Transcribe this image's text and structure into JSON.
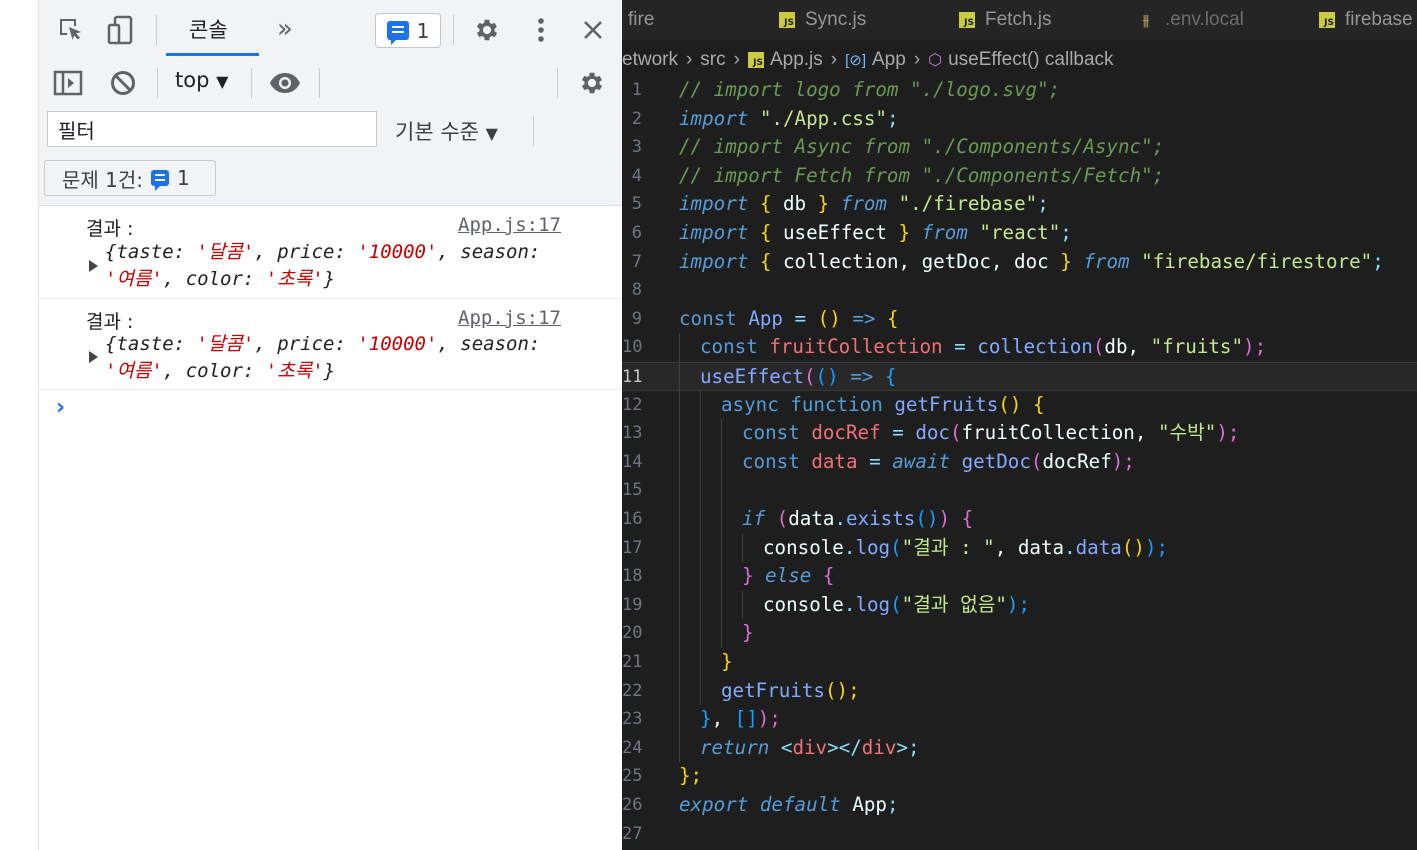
{
  "devtools": {
    "toolbar": {
      "console_tab_label": "콘솔",
      "more_tabs_label": "»",
      "issues_count": "1",
      "context_label": "top"
    },
    "filter": {
      "value": "필터",
      "level_label": "기본 수준"
    },
    "issues_bar": {
      "label": "문제 1건:",
      "count": "1"
    },
    "logs": [
      {
        "prefix": "결과 :",
        "source": "App.js:17",
        "open": "{",
        "k1": "taste: ",
        "v1": "'달콤'",
        "k2": ", price: ",
        "v2": "'10000'",
        "k3": ", season: ",
        "v3": "'여름'",
        "k4": ", color: ",
        "v4": "'초록'",
        "close": "}"
      },
      {
        "prefix": "결과 :",
        "source": "App.js:17",
        "open": "{",
        "k1": "taste: ",
        "v1": "'달콤'",
        "k2": ", price: ",
        "v2": "'10000'",
        "k3": ", season: ",
        "v3": "'여름'",
        "k4": ", color: ",
        "v4": "'초록'",
        "close": "}"
      }
    ],
    "prompt": "›"
  },
  "editor": {
    "tabs": [
      {
        "label": "fire",
        "icon": "none"
      },
      {
        "label": "Sync.js",
        "icon": "js-file-icon"
      },
      {
        "label": "Fetch.js",
        "icon": "js-file-icon"
      },
      {
        "label": ".env.local",
        "icon": "settings-file-icon"
      },
      {
        "label": "firebase",
        "icon": "js-file-icon"
      }
    ],
    "breadcrumb": {
      "part1": "etwork",
      "part2": "src",
      "part3": "App.js",
      "part4": "App",
      "part5": "useEffect() callback"
    },
    "line_numbers": [
      "1",
      "2",
      "3",
      "4",
      "5",
      "6",
      "7",
      "8",
      "9",
      "10",
      "11",
      "12",
      "13",
      "14",
      "15",
      "16",
      "17",
      "18",
      "19",
      "20",
      "21",
      "22",
      "23",
      "24",
      "25",
      "26",
      "27"
    ],
    "code": {
      "l1": [
        "// import logo from \"./logo.svg\";"
      ],
      "l2": [
        "import",
        " ",
        "\"./App.css\"",
        ";"
      ],
      "l3": [
        "// import Async from \"./Components/Async\";"
      ],
      "l4": [
        "// import Fetch from \"./Components/Fetch\";"
      ],
      "l5": [
        "import",
        " ",
        "{",
        " db ",
        "}",
        " ",
        "from",
        " ",
        "\"./firebase\"",
        ";"
      ],
      "l6": [
        "import",
        " ",
        "{",
        " useEffect ",
        "}",
        " ",
        "from",
        " ",
        "\"react\"",
        ";"
      ],
      "l7": [
        "import",
        " ",
        "{",
        " collection, getDoc, doc ",
        "}",
        " ",
        "from",
        " ",
        "\"firebase/firestore\"",
        ";"
      ],
      "l9": [
        "const",
        " ",
        "App",
        " ",
        "=",
        " ",
        "()",
        " ",
        "=>",
        " ",
        "{"
      ],
      "l10": [
        "const",
        " ",
        "fruitCollection",
        " ",
        "=",
        " ",
        "collection",
        "(",
        "db",
        ", ",
        "\"fruits\"",
        ");"
      ],
      "l11": [
        "useEffect",
        "(",
        "()",
        " ",
        "=>",
        " ",
        "{"
      ],
      "l12": [
        "async",
        " ",
        "function",
        " ",
        "getFruits",
        "()",
        " ",
        "{"
      ],
      "l13": [
        "const",
        " ",
        "docRef",
        " ",
        "=",
        " ",
        "doc",
        "(",
        "fruitCollection",
        ", ",
        "\"수박\"",
        ");"
      ],
      "l14": [
        "const",
        " ",
        "data",
        " ",
        "=",
        " ",
        "await",
        " ",
        "getDoc",
        "(",
        "docRef",
        ");"
      ],
      "l16": [
        "if",
        " ",
        "(",
        "data",
        ".",
        "exists",
        "()",
        ")",
        " ",
        "{"
      ],
      "l17": [
        "console",
        ".",
        "log",
        "(",
        "\"결과 : \"",
        ", ",
        "data",
        ".",
        "data",
        "()",
        ");"
      ],
      "l18": [
        "}",
        " ",
        "else",
        " ",
        "{"
      ],
      "l19": [
        "console",
        ".",
        "log",
        "(",
        "\"결과 없음\"",
        ");"
      ],
      "l20": [
        "}"
      ],
      "l21": [
        "}"
      ],
      "l22": [
        "getFruits",
        "();"
      ],
      "l23": [
        "}",
        ", ",
        "[]",
        ");"
      ],
      "l24": [
        "return",
        " ",
        "<",
        "div",
        "></",
        "div",
        ">;"
      ],
      "l25": [
        "};"
      ],
      "l26": [
        "export",
        " ",
        "default",
        " ",
        "App",
        ";"
      ]
    },
    "active_line": "11"
  },
  "colors": {
    "editor_bg": "#1e1e1e",
    "comment": "#6a9955",
    "keyword": "#569cd6",
    "string": "#c3e88d",
    "variable": "#f07178",
    "function": "#82aaff",
    "devtools_accent": "#1a73e8",
    "console_string": "#c80000"
  }
}
